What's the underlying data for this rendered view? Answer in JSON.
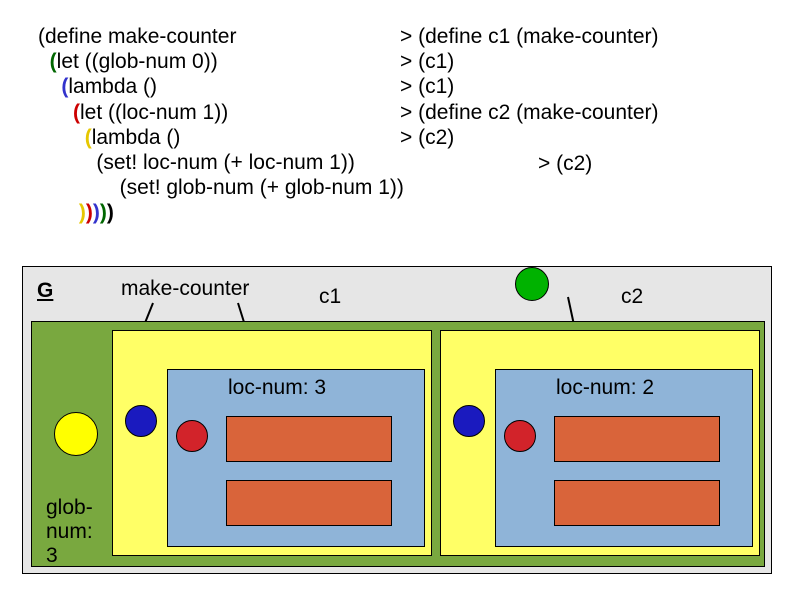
{
  "code": {
    "l1_pre": "(define make-counter",
    "l2_pre": "  ",
    "l2_paren": "(",
    "l2_rest": "let ((glob-num 0))",
    "l3_pre": "    ",
    "l3_paren": "(",
    "l3_rest": "lambda ()",
    "l4_pre": "      ",
    "l4_paren": "(",
    "l4_rest": "let ((loc-num 1))",
    "l5_pre": "        ",
    "l5_paren": "(",
    "l5_rest": "lambda ()",
    "l6": "          (set! loc-num (+ loc-num 1))",
    "l7": "              (set! glob-num (+ glob-num 1))",
    "l8_pre": "       ",
    "close1": ")",
    "close2": ")",
    "close3": ")",
    "close4": ")",
    "close5": ")"
  },
  "repl": {
    "r1": "> (define c1 (make-counter)",
    "r2": "> (c1)",
    "r3": "> (c1)",
    "r4": "> (define c2 (make-counter)",
    "r5": "> (c2)",
    "r6": "> (c2)"
  },
  "env": {
    "g": "G",
    "make_counter": "make-counter",
    "c1": "c1",
    "c2": "c2",
    "glob_num_label": "glob-num: 3",
    "left_loc_num": "loc-num: 3",
    "right_loc_num": "loc-num: 2"
  }
}
